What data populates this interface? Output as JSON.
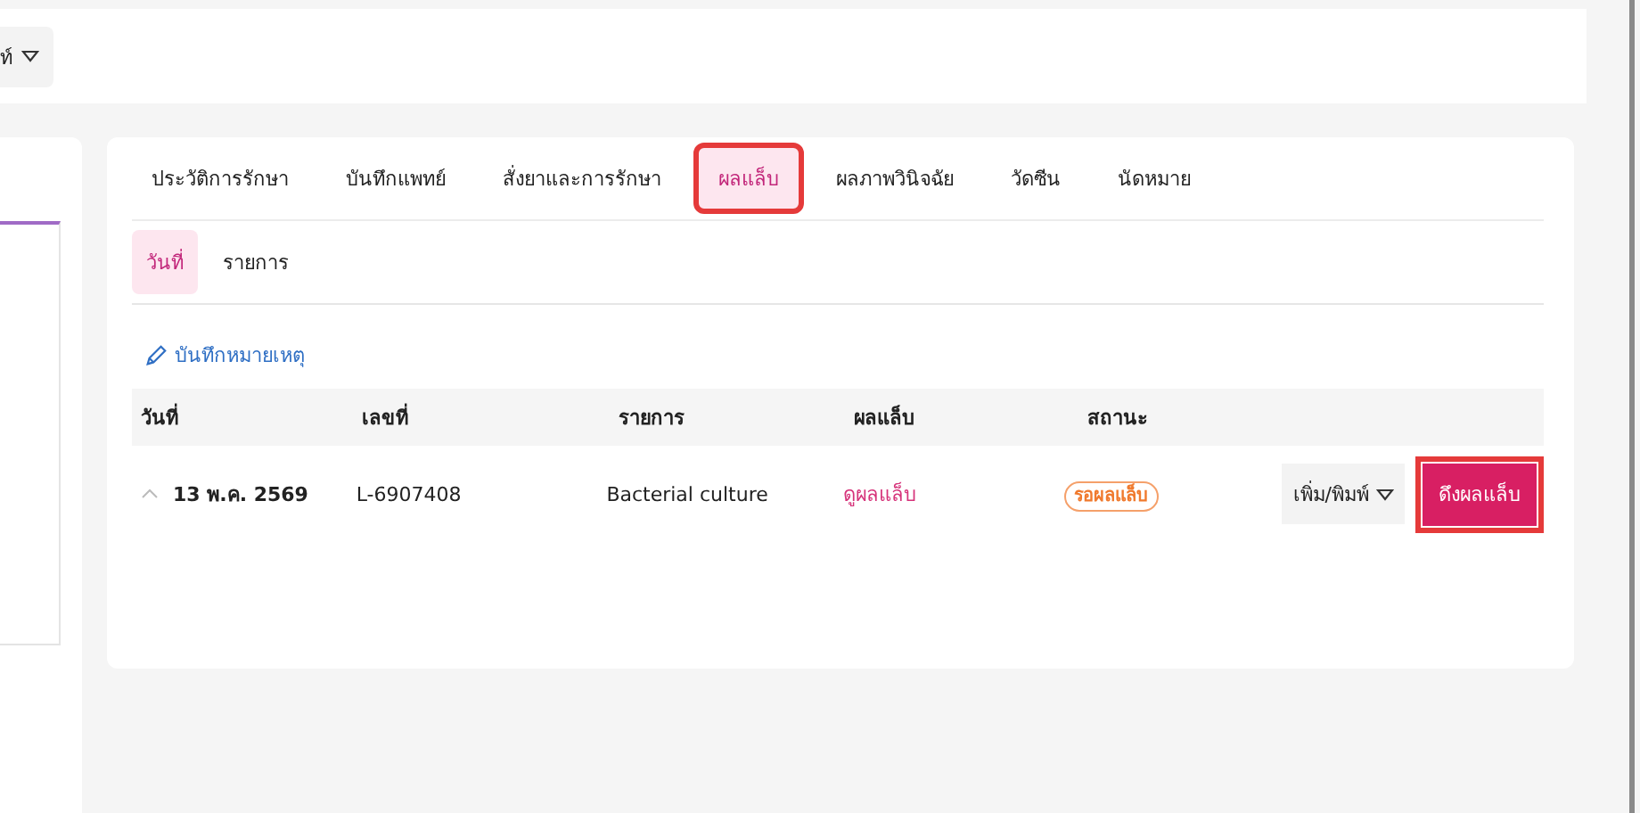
{
  "header": {
    "dropdown": {
      "label": "ท์"
    }
  },
  "tabs": [
    {
      "label": "ประวัติการรักษา",
      "selected": false,
      "highlighted": false
    },
    {
      "label": "บันทึกแพทย์",
      "selected": false,
      "highlighted": false
    },
    {
      "label": "สั่งยาและการรักษา",
      "selected": false,
      "highlighted": false
    },
    {
      "label": "ผลแล็บ",
      "selected": true,
      "highlighted": true
    },
    {
      "label": "ผลภาพวินิจฉัย",
      "selected": false,
      "highlighted": false
    },
    {
      "label": "วัดซีน",
      "selected": false,
      "highlighted": false
    },
    {
      "label": "นัดหมาย",
      "selected": false,
      "highlighted": false
    }
  ],
  "subtabs": [
    {
      "label": "วันที่",
      "selected": true
    },
    {
      "label": "รายการ",
      "selected": false
    }
  ],
  "note_link": "บันทึกหมายเหตุ",
  "table": {
    "columns": [
      "วันที่",
      "เลขที่",
      "รายการ",
      "ผลแล็บ",
      "สถานะ"
    ],
    "rows": [
      {
        "expanded": false,
        "date": "13 พ.ค. 2569",
        "number": "L-6907408",
        "item": "Bacterial culture",
        "result_link": "ดูผลแล็บ",
        "status": "รอผลแล็บ",
        "menu_button": "เพิ่ม/พิมพ์",
        "action_button": {
          "label": "ดึงผลแล็บ",
          "highlighted": true
        }
      }
    ]
  }
}
